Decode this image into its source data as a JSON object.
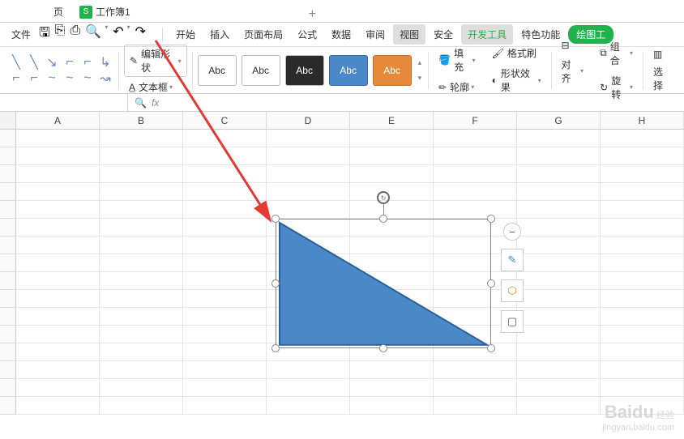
{
  "tabs": {
    "page_label": "页",
    "workbook": "工作簿1",
    "add": "+"
  },
  "menu": {
    "file": "文件",
    "items": [
      "开始",
      "插入",
      "页面布局",
      "公式",
      "数据",
      "审阅",
      "视图",
      "安全",
      "开发工具",
      "特色功能",
      "绘图工"
    ]
  },
  "ribbon": {
    "edit_shape": "编辑形状",
    "text_box": "文本框",
    "sample_label": "Abc",
    "fill": "填充",
    "outline": "轮廓",
    "format_painter": "格式刷",
    "shape_effects": "形状效果",
    "align": "对齐",
    "group": "组合",
    "rotate": "旋转",
    "select": "选择"
  },
  "formula": {
    "fx": "fx"
  },
  "columns": [
    "A",
    "B",
    "C",
    "D",
    "E",
    "F",
    "G",
    "H"
  ],
  "watermark": {
    "brand": "Baidu",
    "sub": "经验",
    "domain": "jingyan.baidu.com"
  }
}
